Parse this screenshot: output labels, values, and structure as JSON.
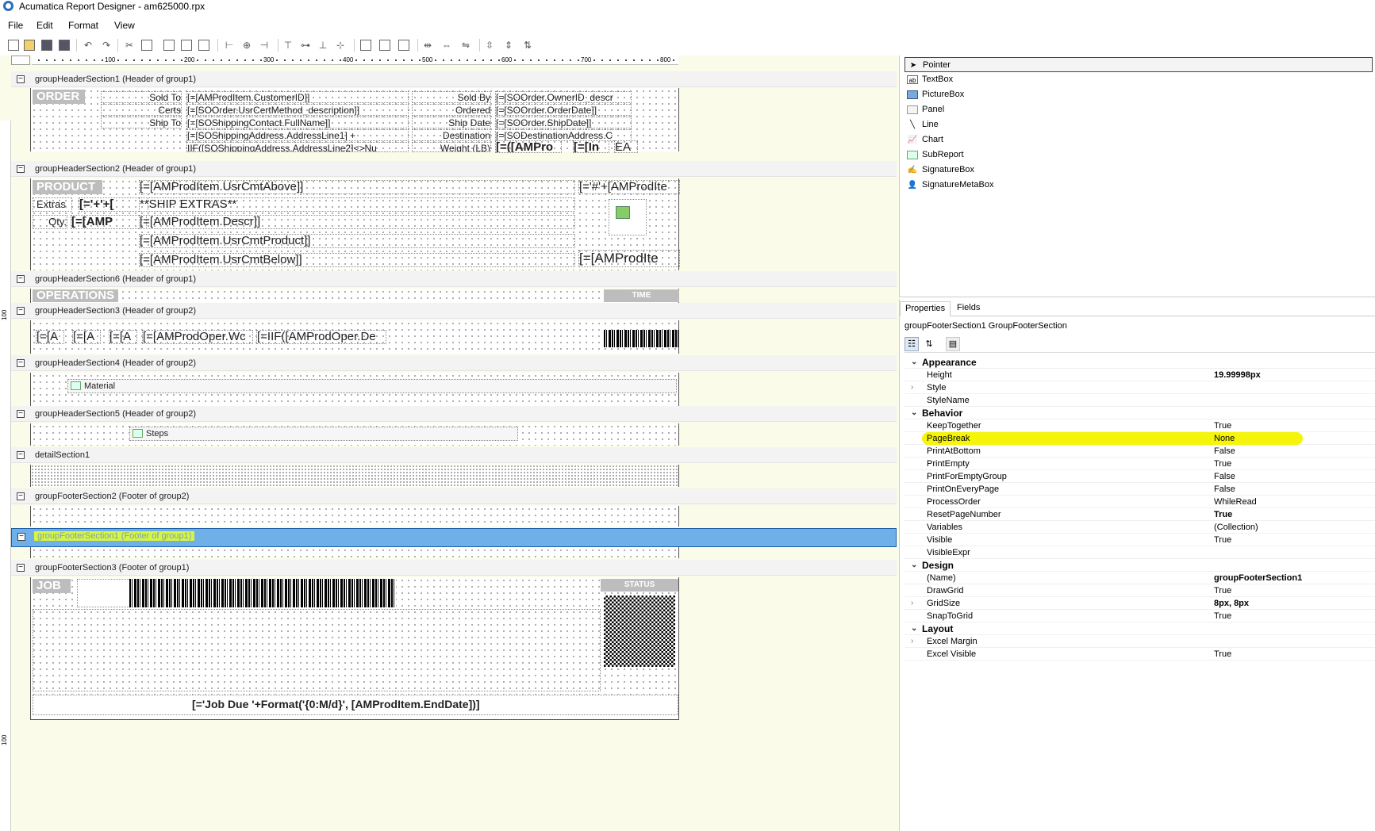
{
  "window": {
    "title": "Acumatica Report Designer - am625000.rpx"
  },
  "menu": [
    "File",
    "Edit",
    "Format",
    "View"
  ],
  "ruler": {
    "h_labels": [
      "100",
      "200",
      "300",
      "400",
      "500",
      "600",
      "700",
      "800"
    ],
    "v_label": "100"
  },
  "sections": [
    {
      "label": "groupHeaderSection1 (Header of group1)"
    },
    {
      "label": "groupHeaderSection2 (Header of group1)"
    },
    {
      "label": "groupHeaderSection6 (Header of group1)"
    },
    {
      "label": "groupHeaderSection3 (Header of group2)"
    },
    {
      "label": "groupHeaderSection4 (Header of group2)"
    },
    {
      "label": "groupHeaderSection5 (Header of group2)"
    },
    {
      "label": "detailSection1"
    },
    {
      "label": "groupFooterSection2 (Footer of group2)"
    },
    {
      "label": "groupFooterSection1 (Footer of group1)"
    },
    {
      "label": "groupFooterSection3 (Footer of group1)"
    }
  ],
  "order": {
    "header": "ORDER",
    "sold_to_label": "Sold To",
    "certs_label": "Certs",
    "ship_to_label": "Ship To",
    "sold_to": "[=[AMProdItem.CustomerID]]",
    "certs": "[=[SOOrder.UsrCertMethod_description]]",
    "ship_to_name": "[=[SOShippingContact.FullName]]",
    "ship_addr1": "[=[SOShippingAddress.AddressLine1] +",
    "ship_addr2": "IIF([SOShippingAddress.AddressLine2]<>Nu",
    "sold_by_label": "Sold By",
    "ordered_label": "Ordered",
    "ship_date_label": "Ship Date",
    "destination_label": "Destination",
    "weight_label": "Weight (LB)",
    "sold_by": "[=[SOOrder.OwnerID_descr",
    "ordered": "[=[SOOrder.OrderDate]]",
    "ship_date": "[=[SOOrder.ShipDate]]",
    "destination": "[=[SODestinationAddress.C",
    "weight1": "[=([AMPro",
    "weight2": "[=[In",
    "weight3": "EA"
  },
  "product": {
    "header": "PRODUCT",
    "extras_label": "Extras",
    "qty_label": "Qty.",
    "extras_val": "[='+'+[",
    "qty_val": "[=[AMP",
    "cmt_above": "[=[AMProdItem.UsrCmtAbove]]",
    "ship_extras": "**SHIP EXTRAS**",
    "descr": "[=[AMProdItem.Descr]]",
    "cmt_product": "[=[AMProdItem.UsrCmtProduct]]",
    "cmt_below": "[=[AMProdItem.UsrCmtBelow]]",
    "right_top": "[='#'+[AMProdIte",
    "right_bottom": "[=[AMProdIte"
  },
  "operations": {
    "header": "OPERATIONS",
    "time_label": "TIME"
  },
  "ops_row": [
    "[=[A",
    "[=[A",
    "[=[A",
    "[=[AMProdOper.Wc",
    "[=IIF([AMProdOper.De"
  ],
  "material": "Material",
  "steps": "Steps",
  "job": {
    "header": "JOB",
    "status_label": "STATUS",
    "due": "[='Job Due '+Format('{0:M/d}', [AMProdItem.EndDate])]"
  },
  "toolbox": [
    "Pointer",
    "TextBox",
    "PictureBox",
    "Panel",
    "Line",
    "Chart",
    "SubReport",
    "SignatureBox",
    "SignatureMetaBox"
  ],
  "props": {
    "tabs": [
      "Properties",
      "Fields"
    ],
    "object": "groupFooterSection1 GroupFooterSection",
    "rows": [
      {
        "type": "cat",
        "k": "Appearance"
      },
      {
        "k": "Height",
        "v": "19.99998px",
        "bold": true
      },
      {
        "k": "Style",
        "v": "",
        "expand": true
      },
      {
        "k": "StyleName",
        "v": ""
      },
      {
        "type": "cat",
        "k": "Behavior"
      },
      {
        "k": "KeepTogether",
        "v": "True"
      },
      {
        "k": "PageBreak",
        "v": "None",
        "highlight": true
      },
      {
        "k": "PrintAtBottom",
        "v": "False"
      },
      {
        "k": "PrintEmpty",
        "v": "True"
      },
      {
        "k": "PrintForEmptyGroup",
        "v": "False"
      },
      {
        "k": "PrintOnEveryPage",
        "v": "False"
      },
      {
        "k": "ProcessOrder",
        "v": "WhileRead"
      },
      {
        "k": "ResetPageNumber",
        "v": "True",
        "bold": true
      },
      {
        "k": "Variables",
        "v": "(Collection)"
      },
      {
        "k": "Visible",
        "v": "True"
      },
      {
        "k": "VisibleExpr",
        "v": ""
      },
      {
        "type": "cat",
        "k": "Design"
      },
      {
        "k": "(Name)",
        "v": "groupFooterSection1",
        "bold": true
      },
      {
        "k": "DrawGrid",
        "v": "True"
      },
      {
        "k": "GridSize",
        "v": "8px, 8px",
        "bold": true,
        "expand": true
      },
      {
        "k": "SnapToGrid",
        "v": "True"
      },
      {
        "type": "cat",
        "k": "Layout"
      },
      {
        "k": "Excel Margin",
        "v": "",
        "expand": true
      },
      {
        "k": "Excel Visible",
        "v": "True"
      }
    ]
  }
}
